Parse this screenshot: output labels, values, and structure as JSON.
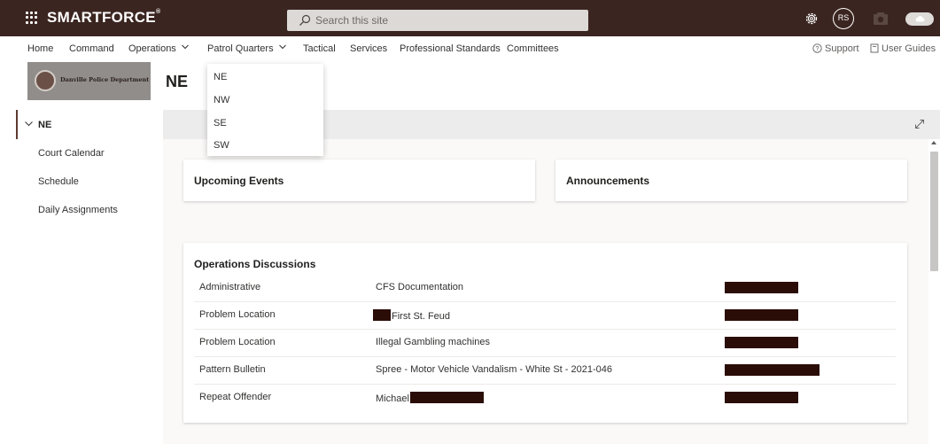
{
  "suite_bar": {
    "brand": "SMARTFORCE",
    "search_placeholder": "Search this site",
    "user_initials": "RS"
  },
  "nav": {
    "items": [
      {
        "label": "Home",
        "has_dropdown": false
      },
      {
        "label": "Command",
        "has_dropdown": false
      },
      {
        "label": "Operations",
        "has_dropdown": true
      },
      {
        "label": "Patrol Quarters",
        "has_dropdown": true
      },
      {
        "label": "Tactical",
        "has_dropdown": false
      },
      {
        "label": "Services",
        "has_dropdown": false
      },
      {
        "label": "Professional Standards",
        "has_dropdown": false
      },
      {
        "label": "Committees",
        "has_dropdown": false
      }
    ],
    "support_label": "Support",
    "user_guides_label": "User Guides"
  },
  "dropdown": {
    "items": [
      "NE",
      "NW",
      "SE",
      "SW"
    ]
  },
  "site": {
    "logo_text": "Danville Police Department",
    "title": "NE"
  },
  "left_nav": {
    "active": "NE",
    "items": [
      "Court Calendar",
      "Schedule",
      "Daily Assignments"
    ]
  },
  "webparts": {
    "upcoming_events": "Upcoming Events",
    "announcements": "Announcements",
    "operations_discussions": {
      "title": "Operations Discussions",
      "rows": [
        {
          "category": "Administrative",
          "subject": "CFS Documentation"
        },
        {
          "category": "Problem Location",
          "subject": "First St. Feud"
        },
        {
          "category": "Problem Location",
          "subject": "Illegal Gambling machines"
        },
        {
          "category": "Pattern Bulletin",
          "subject": "Spree - Motor Vehicle Vandalism - White St - 2021-046"
        },
        {
          "category": "Repeat Offender",
          "subject": "Michael"
        }
      ]
    }
  },
  "colors": {
    "suite_bar": "#3b2520",
    "redaction": "#2b0d08",
    "accent": "#5d3a31"
  }
}
